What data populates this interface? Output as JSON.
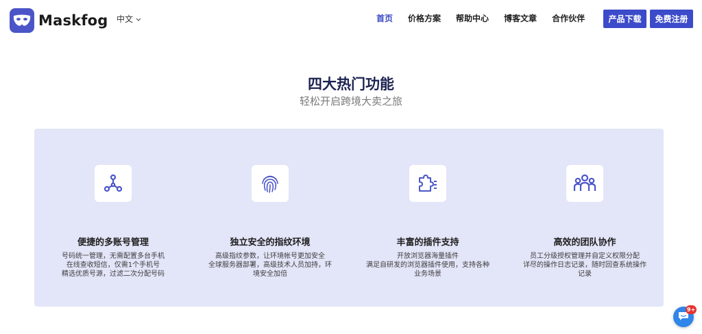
{
  "header": {
    "brand": "Maskfog",
    "language": "中文",
    "nav": [
      {
        "label": "首页",
        "active": true
      },
      {
        "label": "价格方案",
        "active": false
      },
      {
        "label": "帮助中心",
        "active": false
      },
      {
        "label": "博客文章",
        "active": false
      },
      {
        "label": "合作伙伴",
        "active": false
      }
    ],
    "download_label": "产品下载",
    "register_label": "免费注册"
  },
  "section": {
    "title": "四大热门功能",
    "subtitle": "轻松开启跨境大卖之旅"
  },
  "features": [
    {
      "icon": "share-nodes-icon",
      "title": "便捷的多账号管理",
      "desc": [
        "号码统一管理，无需配置多台手机",
        "在线查收短信，仅需1个手机号",
        "精选优质号源，过滤二次分配号码"
      ]
    },
    {
      "icon": "fingerprint-icon",
      "title": "独立安全的指纹环境",
      "desc": [
        "高级指纹参数，让环境帐号更加安全",
        "全球服务器部署，高级技术人员加持，环",
        "境安全加倍"
      ]
    },
    {
      "icon": "puzzle-list-icon",
      "title": "丰富的插件支持",
      "desc": [
        "开放浏览器海量插件",
        "满足自研发的浏览器插件使用，支持各种",
        "业务场景"
      ]
    },
    {
      "icon": "team-icon",
      "title": "高效的团队协作",
      "desc": [
        "员工分级授权管理并自定义权限分配",
        "详尽的操作日志记录，随时回查系统操作",
        "记录"
      ]
    }
  ],
  "chat": {
    "badge": "9+",
    "icon": "chat-icon"
  },
  "colors": {
    "accent": "#3c4bc9",
    "panel": "#e3e5f8",
    "icon": "#4b55c8",
    "badge": "#e5342f",
    "chat": "#2f85e8"
  }
}
